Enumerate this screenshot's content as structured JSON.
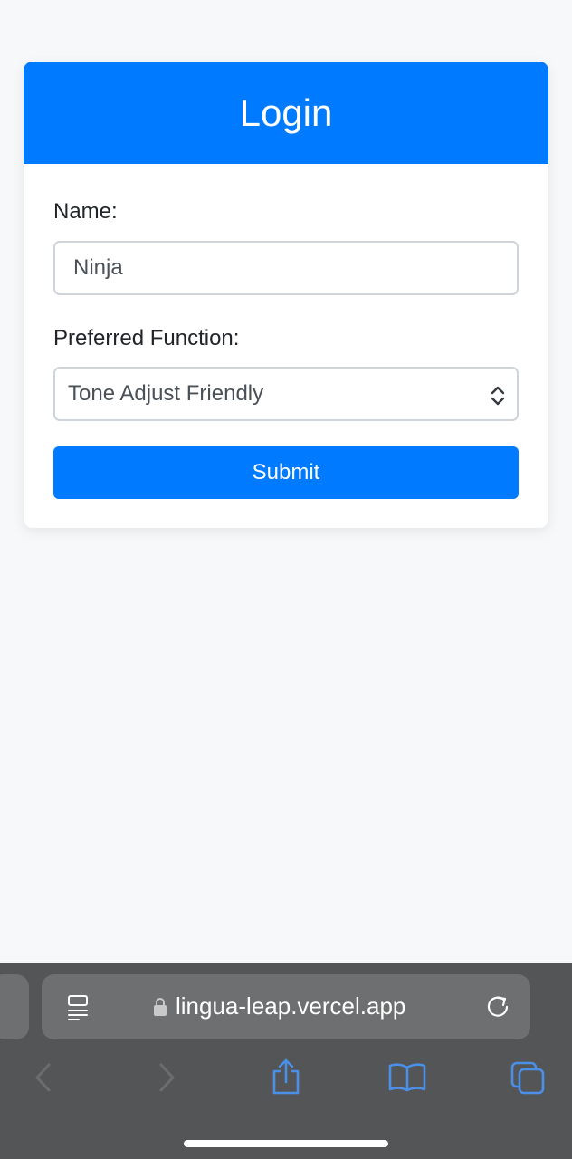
{
  "login": {
    "title": "Login",
    "name_label": "Name:",
    "name_value": "Ninja",
    "function_label": "Preferred Function:",
    "function_selected": "Tone Adjust Friendly",
    "submit_label": "Submit"
  },
  "browser": {
    "url": "lingua-leap.vercel.app",
    "icons": {
      "reader": "reader-mode-icon",
      "lock": "lock-icon",
      "reload": "reload-icon",
      "back": "back-icon",
      "forward": "forward-icon",
      "share": "share-icon",
      "bookmarks": "bookmarks-icon",
      "tabs": "tabs-icon"
    }
  },
  "colors": {
    "primary": "#007bff",
    "page_bg": "#f7f8fa",
    "toolbar_bg": "#545556",
    "toolbar_blue": "#4a8fe8"
  }
}
